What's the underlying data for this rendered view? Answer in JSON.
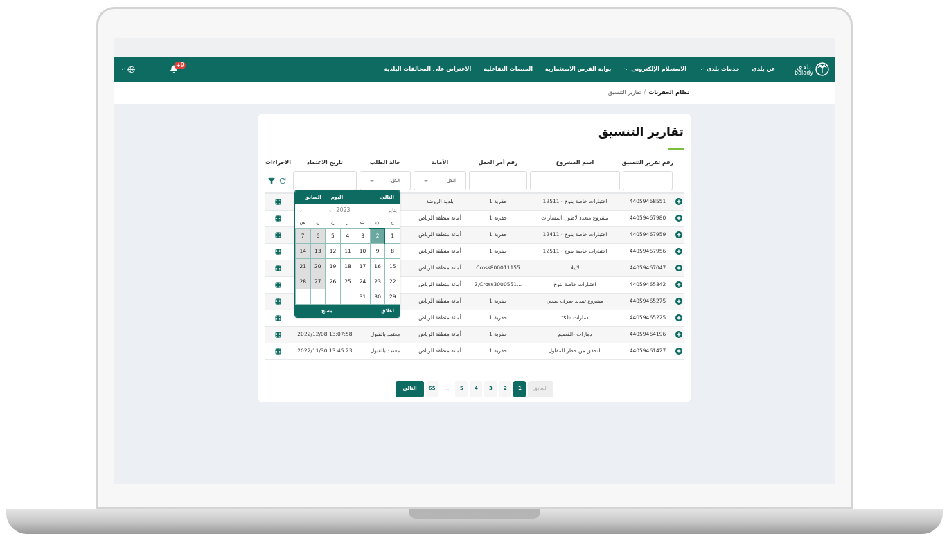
{
  "navbar": {
    "logo": {
      "arabic": "بلدي",
      "latin": "balady"
    },
    "items": [
      {
        "label": "عن بلدي",
        "dropdown": false
      },
      {
        "label": "خدمات بلدي",
        "dropdown": true
      },
      {
        "label": "الاستعلام الإلكتروني",
        "dropdown": true
      },
      {
        "label": "بوابة الفرص الاستثمارية",
        "dropdown": false
      },
      {
        "label": "المنصات التفاعلية",
        "dropdown": false
      },
      {
        "label": "الاعتراض على المخالفات البلدية",
        "dropdown": false
      }
    ],
    "notifications_badge": "+9"
  },
  "breadcrumb_separator": "/",
  "breadcrumb": [
    {
      "label": "نظام الحفريات",
      "current": false
    },
    {
      "label": "تقارير التنسيق",
      "current": true
    }
  ],
  "page_title": "تقارير التنسيق",
  "table": {
    "columns": [
      "رقم تقرير التنسيق",
      "اسم المشروع",
      "رقم أمر العمل",
      "الأمانة",
      "حالة الطلب",
      "تاريخ الاعتماد",
      "الاجراءات"
    ],
    "filters": [
      {
        "kind": "text"
      },
      {
        "kind": "text"
      },
      {
        "kind": "text"
      },
      {
        "kind": "select",
        "value": "الكل"
      },
      {
        "kind": "select",
        "value": "الكل"
      },
      {
        "kind": "text"
      }
    ],
    "rows": [
      {
        "number": "44059468551",
        "project": "اختبارات خاصة بنوج - 12511",
        "work_order": "حفرية 1",
        "amanah": "بلدية الروضة"
      },
      {
        "number": "44059467980",
        "project": "مشروع متعدد لاطول المسارات",
        "work_order": "حفرية 1",
        "amanah": "أمانة منطقة الرياض"
      },
      {
        "number": "44059467959",
        "project": "اختبارات خاصة بنوج - 12411",
        "work_order": "حفرية 1",
        "amanah": "أمانة منطقة الرياض"
      },
      {
        "number": "44059467956",
        "project": "اختبارات خاصة بنوج - 12511",
        "work_order": "حفرية 1",
        "amanah": "أمانة منطقة الرياض"
      },
      {
        "number": "44059467047",
        "project": "لايبلا",
        "work_order": "Cross800011155",
        "amanah": "أمانة منطقة الرياض"
      },
      {
        "number": "44059465342",
        "project": "اختبارات خاصة بنوج",
        "work_order": "2,Cross3000551...",
        "amanah": "أمانة منطقة الرياض"
      },
      {
        "number": "44059465275",
        "project": "مشروع تمديد صرف صحي",
        "work_order": "حفرية 1",
        "amanah": "أمانة منطقة الرياض"
      },
      {
        "number": "44059465225",
        "project": "دمارات -ts1",
        "work_order": "حفرية 1",
        "amanah": "أمانة منطقة الرياض"
      },
      {
        "number": "44059464196",
        "project": "دمارات -القصيم",
        "work_order": "حفرية 1",
        "amanah": "أمانة منطقة الرياض",
        "status": "معتمد بالقبول",
        "date": "2022/12/08 13:07:58"
      },
      {
        "number": "44059461427",
        "project": "التحقق من حظر المقاول",
        "work_order": "حفرية 1",
        "amanah": "أمانة منطقة الرياض",
        "status": "معتمد بالقبول",
        "date": "2022/11/30 13:45:23"
      }
    ]
  },
  "calendar": {
    "next": "التالي",
    "today": "اليوم",
    "previous": "السابق",
    "month": "يناير",
    "year": "2023",
    "weekdays": [
      "ح",
      "ن",
      "ث",
      "ر",
      "خ",
      "ج",
      "س"
    ],
    "weeks": [
      [
        {
          "day": "1",
          "selected": false
        },
        {
          "day": "2",
          "selected": true
        },
        {
          "day": "3",
          "selected": false
        },
        {
          "day": "4",
          "selected": false
        },
        {
          "day": "5",
          "selected": false
        },
        {
          "day": "6",
          "selected": false
        },
        {
          "day": "7",
          "selected": false
        }
      ],
      [
        {
          "day": "8",
          "selected": false
        },
        {
          "day": "9",
          "selected": false
        },
        {
          "day": "10",
          "selected": false
        },
        {
          "day": "11",
          "selected": false
        },
        {
          "day": "12",
          "selected": false
        },
        {
          "day": "13",
          "selected": false
        },
        {
          "day": "14",
          "selected": false
        }
      ],
      [
        {
          "day": "15",
          "selected": false
        },
        {
          "day": "16",
          "selected": false
        },
        {
          "day": "17",
          "selected": false
        },
        {
          "day": "18",
          "selected": false
        },
        {
          "day": "19",
          "selected": false
        },
        {
          "day": "20",
          "selected": false
        },
        {
          "day": "21",
          "selected": false
        }
      ],
      [
        {
          "day": "22",
          "selected": false
        },
        {
          "day": "23",
          "selected": false
        },
        {
          "day": "24",
          "selected": false
        },
        {
          "day": "25",
          "selected": false
        },
        {
          "day": "26",
          "selected": false
        },
        {
          "day": "27",
          "selected": false
        },
        {
          "day": "28",
          "selected": false
        }
      ],
      [
        {
          "day": "29",
          "selected": false
        },
        {
          "day": "30",
          "selected": false
        },
        {
          "day": "31",
          "selected": false
        }
      ]
    ],
    "close": "اغلاق",
    "clear": "مسح"
  },
  "pagination": [
    {
      "kind": "prev",
      "label": "السابق",
      "disabled": true
    },
    {
      "kind": "page",
      "label": "1",
      "selected": true
    },
    {
      "kind": "page",
      "label": "2",
      "selected": false
    },
    {
      "kind": "page",
      "label": "3",
      "selected": false
    },
    {
      "kind": "page",
      "label": "4",
      "selected": false
    },
    {
      "kind": "page",
      "label": "5",
      "selected": false
    },
    {
      "kind": "gap",
      "label": "..."
    },
    {
      "kind": "page",
      "label": "65",
      "selected": false
    },
    {
      "kind": "next",
      "label": "التالي",
      "disabled": false
    }
  ]
}
